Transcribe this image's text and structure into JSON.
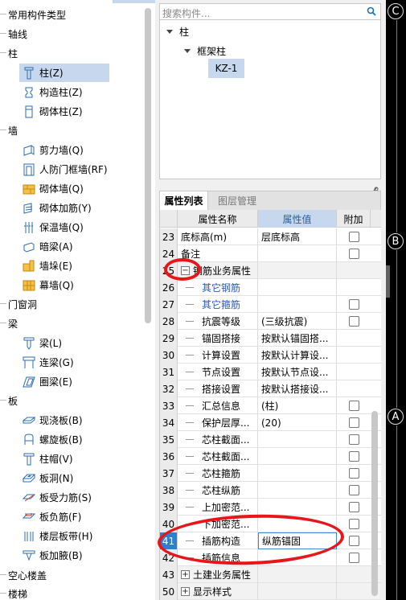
{
  "left_tree": {
    "groups": [
      {
        "label": "常用构件类型",
        "items": []
      },
      {
        "label": "轴线",
        "items": []
      },
      {
        "label": "柱",
        "items": [
          {
            "label": "柱(Z)",
            "icon": "column-icon",
            "selected": true
          },
          {
            "label": "构造柱(Z)",
            "icon": "constructional-column-icon"
          },
          {
            "label": "砌体柱(Z)",
            "icon": "masonry-column-icon"
          }
        ]
      },
      {
        "label": "墙",
        "items": [
          {
            "label": "剪力墙(Q)",
            "icon": "shear-wall-icon"
          },
          {
            "label": "人防门框墙(RF)",
            "icon": "civil-defense-door-wall-icon"
          },
          {
            "label": "砌体墙(Q)",
            "icon": "masonry-wall-icon"
          },
          {
            "label": "砌体加筋(Y)",
            "icon": "masonry-reinforcement-icon"
          },
          {
            "label": "保温墙(Q)",
            "icon": "insulation-wall-icon"
          },
          {
            "label": "暗梁(A)",
            "icon": "hidden-beam-icon"
          },
          {
            "label": "墙垛(E)",
            "icon": "wall-pier-icon"
          },
          {
            "label": "幕墙(Q)",
            "icon": "curtain-wall-icon"
          }
        ]
      },
      {
        "label": "门窗洞",
        "items": []
      },
      {
        "label": "梁",
        "items": [
          {
            "label": "梁(L)",
            "icon": "beam-icon"
          },
          {
            "label": "连梁(G)",
            "icon": "coupling-beam-icon"
          },
          {
            "label": "圈梁(E)",
            "icon": "ring-beam-icon"
          }
        ]
      },
      {
        "label": "板",
        "items": [
          {
            "label": "现浇板(B)",
            "icon": "cast-slab-icon"
          },
          {
            "label": "螺旋板(B)",
            "icon": "spiral-slab-icon"
          },
          {
            "label": "柱帽(V)",
            "icon": "column-cap-icon"
          },
          {
            "label": "板洞(N)",
            "icon": "slab-hole-icon"
          },
          {
            "label": "板受力筋(S)",
            "icon": "slab-main-rebar-icon"
          },
          {
            "label": "板负筋(F)",
            "icon": "slab-negative-rebar-icon"
          },
          {
            "label": "楼层板带(H)",
            "icon": "floor-slab-strip-icon"
          },
          {
            "label": "板加腋(B)",
            "icon": "slab-haunch-icon"
          }
        ]
      },
      {
        "label": "空心楼盖",
        "items": []
      },
      {
        "label": "楼梯",
        "items": []
      }
    ]
  },
  "search": {
    "placeholder": "搜索构件..."
  },
  "component_tree": {
    "root": "柱",
    "child": "框架柱",
    "leaf": "KZ-1"
  },
  "tabs": {
    "properties": "属性列表",
    "layers": "图层管理"
  },
  "grid": {
    "headers": {
      "name": "属性名称",
      "value": "属性值",
      "add": "附加"
    },
    "rows": [
      {
        "num": "23",
        "name": "底标高(m)",
        "value": "层底标高",
        "checkbox": true
      },
      {
        "num": "24",
        "name": "备注",
        "value": "",
        "checkbox": true
      },
      {
        "num": "25",
        "name": "钢筋业务属性",
        "value": "",
        "group": true,
        "expanded": true
      },
      {
        "num": "26",
        "name": "其它钢筋",
        "value": "",
        "blue": true
      },
      {
        "num": "27",
        "name": "其它箍筋",
        "value": "",
        "blue": true,
        "checkbox": true
      },
      {
        "num": "28",
        "name": "抗震等级",
        "value": "(三级抗震)",
        "checkbox": true
      },
      {
        "num": "29",
        "name": "锚固搭接",
        "value": "按默认锚固搭..."
      },
      {
        "num": "30",
        "name": "计算设置",
        "value": "按默认计算设..."
      },
      {
        "num": "31",
        "name": "节点设置",
        "value": "按默认节点设..."
      },
      {
        "num": "32",
        "name": "搭接设置",
        "value": "按默认搭接设..."
      },
      {
        "num": "33",
        "name": "汇总信息",
        "value": "(柱)",
        "checkbox": true
      },
      {
        "num": "34",
        "name": "保护层厚...",
        "value": "(20)",
        "checkbox": true
      },
      {
        "num": "35",
        "name": "芯柱截面...",
        "value": "",
        "checkbox": true
      },
      {
        "num": "36",
        "name": "芯柱截面...",
        "value": "",
        "checkbox": true
      },
      {
        "num": "37",
        "name": "芯柱箍筋",
        "value": "",
        "checkbox": true
      },
      {
        "num": "38",
        "name": "芯柱纵筋",
        "value": "",
        "checkbox": true
      },
      {
        "num": "39",
        "name": "上加密范...",
        "value": "",
        "checkbox": true
      },
      {
        "num": "40",
        "name": "下加密范...",
        "value": "",
        "checkbox": true
      },
      {
        "num": "41",
        "name": "插筋构造",
        "value": "纵筋锚固",
        "checkbox": true,
        "highlight": true
      },
      {
        "num": "42",
        "name": "插筋信息",
        "value": "",
        "checkbox": true
      },
      {
        "num": "43",
        "name": "土建业务属性",
        "value": "",
        "group": true,
        "expanded": false
      },
      {
        "num": "50",
        "name": "显示样式",
        "value": "",
        "group": true,
        "expanded": false
      }
    ]
  },
  "canvas": {
    "axis_labels": [
      "C",
      "B",
      "A"
    ],
    "line_color": "#1fbf1f"
  },
  "annotation_color": "#e8161b"
}
